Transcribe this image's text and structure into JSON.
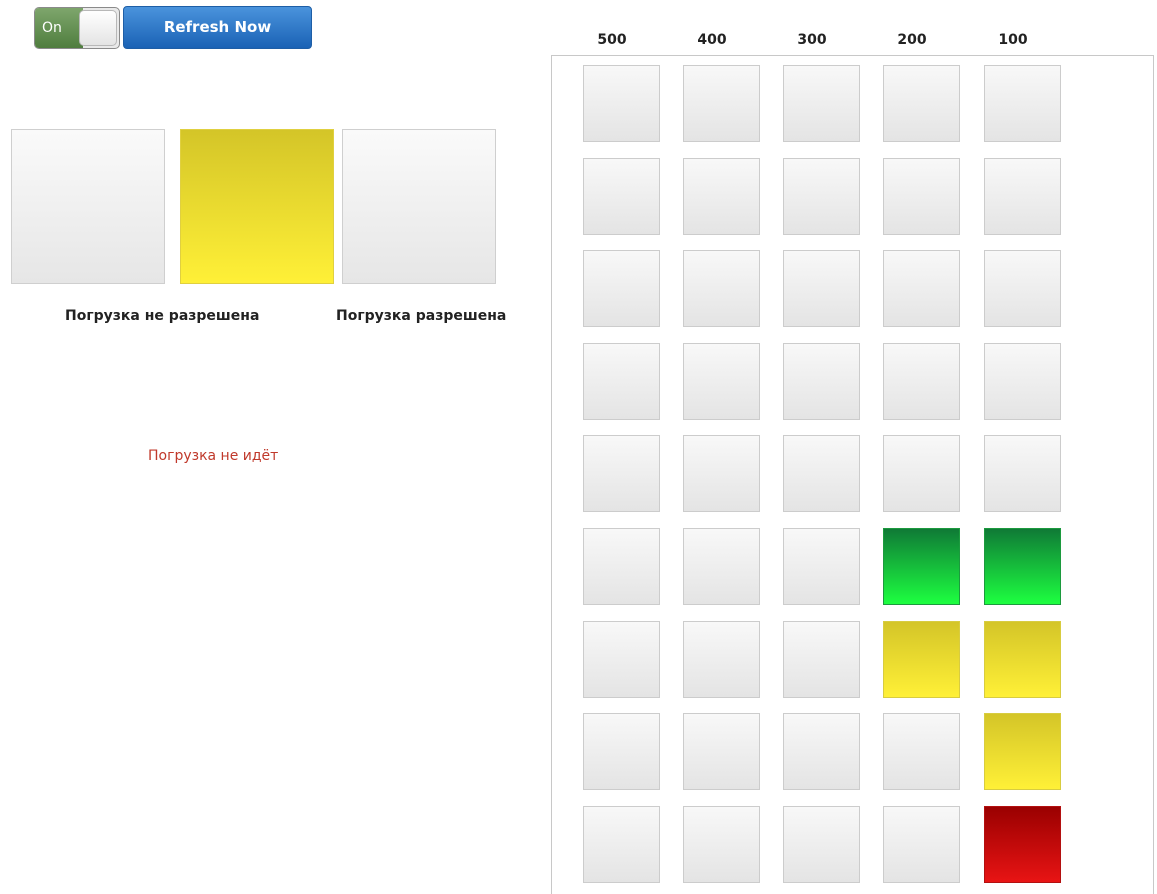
{
  "toggle": {
    "label": "On",
    "state": "on"
  },
  "refresh": {
    "label": "Refresh Now"
  },
  "indicators": [
    {
      "state": "empty"
    },
    {
      "state": "yellow"
    },
    {
      "state": "empty"
    }
  ],
  "captions": {
    "not_allowed": "Погрузка не разрешена",
    "allowed": "Погрузка разрешена"
  },
  "status": {
    "text": "Погрузка не идёт",
    "color": "#c0392b"
  },
  "grid": {
    "columns": [
      "500",
      "400",
      "300",
      "200",
      "100"
    ],
    "rows": [
      [
        "empty",
        "empty",
        "empty",
        "empty",
        "empty"
      ],
      [
        "empty",
        "empty",
        "empty",
        "empty",
        "empty"
      ],
      [
        "empty",
        "empty",
        "empty",
        "empty",
        "empty"
      ],
      [
        "empty",
        "empty",
        "empty",
        "empty",
        "empty"
      ],
      [
        "empty",
        "empty",
        "empty",
        "empty",
        "empty"
      ],
      [
        "empty",
        "empty",
        "empty",
        "green",
        "green"
      ],
      [
        "empty",
        "empty",
        "empty",
        "yellow",
        "yellow"
      ],
      [
        "empty",
        "empty",
        "empty",
        "empty",
        "yellow"
      ],
      [
        "empty",
        "empty",
        "empty",
        "empty",
        "red"
      ]
    ]
  },
  "colors": {
    "yellow": "#fff037",
    "green": "#1dff40",
    "red": "#e81414",
    "button_blue": "#1a62b5",
    "toggle_green": "#4f7d3e"
  }
}
